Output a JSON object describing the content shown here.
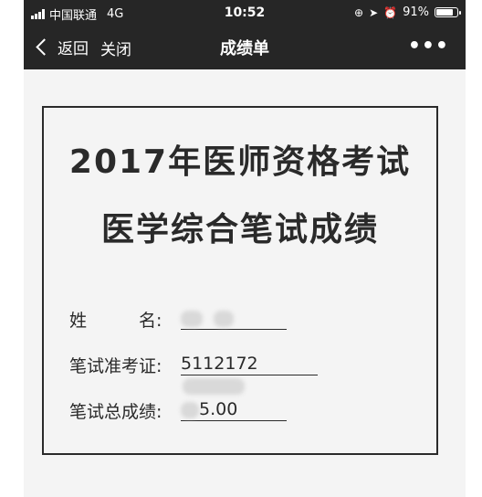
{
  "status_bar": {
    "carrier": "中国联通",
    "network": "4G",
    "time": "10:52",
    "battery": "91%",
    "battery_level": 0.91
  },
  "nav": {
    "back_label": "返回",
    "close_label": "关闭",
    "title": "成绩单",
    "more_label": "•••"
  },
  "certificate": {
    "title_line1": "2017年医师资格考试",
    "title_line2": "医学综合笔试成绩",
    "fields": [
      {
        "label": "姓　　　名:",
        "value": ""
      },
      {
        "label": "笔试准考证:",
        "value": "5112172"
      },
      {
        "label": "笔试总成绩:",
        "value": "5.00"
      }
    ]
  },
  "colors": {
    "bar": "#262626",
    "page": "#f4f4f4",
    "ink": "#2a2a2a"
  }
}
